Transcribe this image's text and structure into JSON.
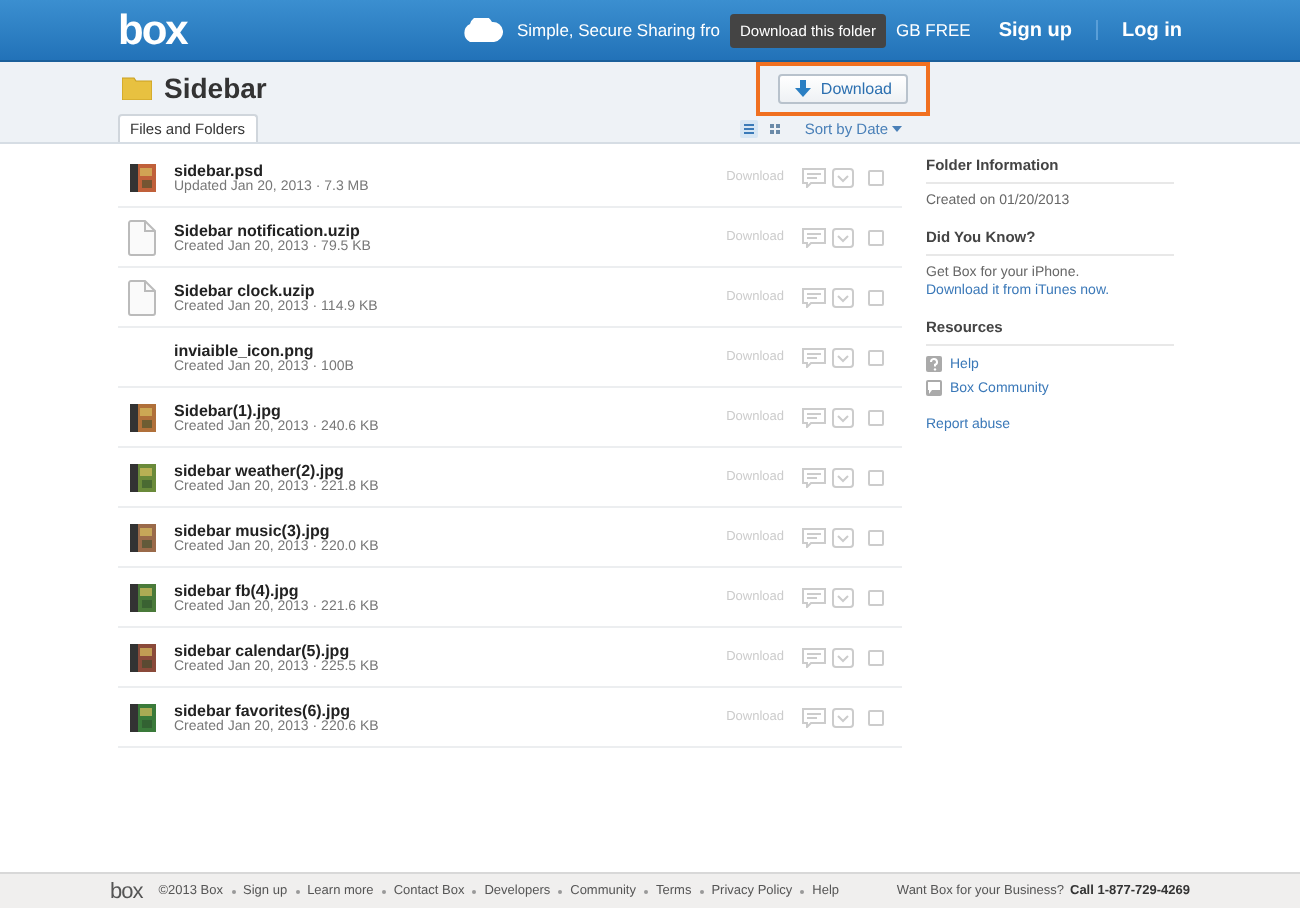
{
  "header": {
    "logo": "box",
    "tagline_start": "Simple, Secure Sharing fro",
    "tagline_end": "GB FREE",
    "links": [
      "Sign up",
      "Log in"
    ]
  },
  "tooltip": "Download this folder",
  "folder": {
    "title": "Sidebar",
    "download_button": "Download",
    "highlighted": true
  },
  "tabs": [
    {
      "label": "Files and Folders",
      "selected": true
    }
  ],
  "view_modes": [
    {
      "kind": "list",
      "selected": true
    },
    {
      "kind": "grid",
      "selected": false
    }
  ],
  "sort": "Sort by Date",
  "files": [
    {
      "name": "sidebar.psd",
      "meta": "Updated Jan 20, 2013 · 7.3 MB",
      "kind": "image",
      "color": "#c0603a",
      "action": "Download",
      "checked": false
    },
    {
      "name": "Sidebar notification.uzip",
      "meta": "Created Jan 20, 2013 · 79.5 KB",
      "kind": "document",
      "action": "Download",
      "checked": false
    },
    {
      "name": "Sidebar clock.uzip",
      "meta": "Created Jan 20, 2013 · 114.9 KB",
      "kind": "document",
      "action": "Download",
      "checked": false
    },
    {
      "name": "inviaible_icon.png",
      "meta": "Created Jan 20, 2013 · 100B",
      "kind": "none",
      "action": "Download",
      "checked": false
    },
    {
      "name": "Sidebar(1).jpg",
      "meta": "Created Jan 20, 2013 · 240.6 KB",
      "kind": "image",
      "color": "#b0703a",
      "action": "Download",
      "checked": false
    },
    {
      "name": "sidebar weather(2).jpg",
      "meta": "Created Jan 20, 2013 · 221.8 KB",
      "kind": "image",
      "color": "#6a8a3a",
      "action": "Download",
      "checked": false
    },
    {
      "name": "sidebar music(3).jpg",
      "meta": "Created Jan 20, 2013 · 220.0 KB",
      "kind": "image",
      "color": "#9a6a4a",
      "action": "Download",
      "checked": false
    },
    {
      "name": "sidebar fb(4).jpg",
      "meta": "Created Jan 20, 2013 · 221.6 KB",
      "kind": "image",
      "color": "#4a7a3a",
      "action": "Download",
      "checked": false
    },
    {
      "name": "sidebar calendar(5).jpg",
      "meta": "Created Jan 20, 2013 · 225.5 KB",
      "kind": "image",
      "color": "#8a4a3a",
      "action": "Download",
      "checked": false
    },
    {
      "name": "sidebar favorites(6).jpg",
      "meta": "Created Jan 20, 2013 · 220.6 KB",
      "kind": "image",
      "color": "#3a7a3a",
      "action": "Download",
      "checked": false
    }
  ],
  "sidebar": {
    "sections": [
      {
        "title": "Folder Information",
        "lines": [
          {
            "kind": "text",
            "text": "Created on 01/20/2013"
          }
        ]
      },
      {
        "title": "Did You Know?",
        "lines": [
          {
            "kind": "text",
            "text": "Get Box for your iPhone."
          },
          {
            "kind": "link",
            "text": "Download it from iTunes now."
          }
        ]
      },
      {
        "title": "Resources",
        "lines": [
          {
            "kind": "help",
            "text": "Help"
          },
          {
            "kind": "community",
            "text": "Box Community"
          }
        ]
      }
    ],
    "report": "Report abuse"
  },
  "footer": {
    "logo": "box",
    "copyright": "©2013 Box",
    "links": [
      "Sign up",
      "Learn more",
      "Contact Box",
      "Developers",
      "Community",
      "Terms",
      "Privacy Policy",
      "Help"
    ],
    "business": "Want Box for your Business?",
    "phone": "Call 1-877-729-4269"
  }
}
